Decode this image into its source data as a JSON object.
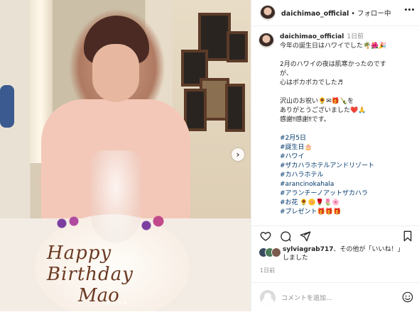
{
  "header": {
    "username": "daichimao_official",
    "separator": " • ",
    "follow_status": "フォロー中"
  },
  "post": {
    "cake_text_line1": "Happy Birthday",
    "cake_text_line2": "Mao"
  },
  "caption": {
    "username": "daichimao_official",
    "time": "1日前",
    "lines": [
      "今年の誕生日はハワイでした🌴🌺🎉",
      "",
      "2月のハワイの夜は肌寒かったのです",
      "が、",
      "心はポカポカでした♬",
      "",
      "沢山のお祝い🌻✉🎁🍾を",
      "ありがとうございました❤️🙏",
      "感謝‼感謝‼です。",
      ""
    ],
    "hashtags": [
      "#2月5日",
      "#誕生日🎂",
      "#ハワイ",
      "#ザカハラホテルアンドリゾート",
      "#カハラホテル",
      "#arancinokahala",
      "#アランチーノアットザカハラ",
      "#お花 🌻🌼🌹🌷🌸",
      "#プレゼント🎁🎁🎁"
    ]
  },
  "likes": {
    "user": "sylviagrab717",
    "middle": "、その他",
    "suffix": "が「いいね！」",
    "suffix2": "しました"
  },
  "date": "1日前",
  "comment": {
    "placeholder": "コメントを追加..."
  },
  "icons": {
    "more": "more-icon",
    "like": "heart-icon",
    "comment": "comment-icon",
    "share": "share-icon",
    "save": "bookmark-icon",
    "emoji": "emoji-icon",
    "next": "chevron-right-icon"
  }
}
